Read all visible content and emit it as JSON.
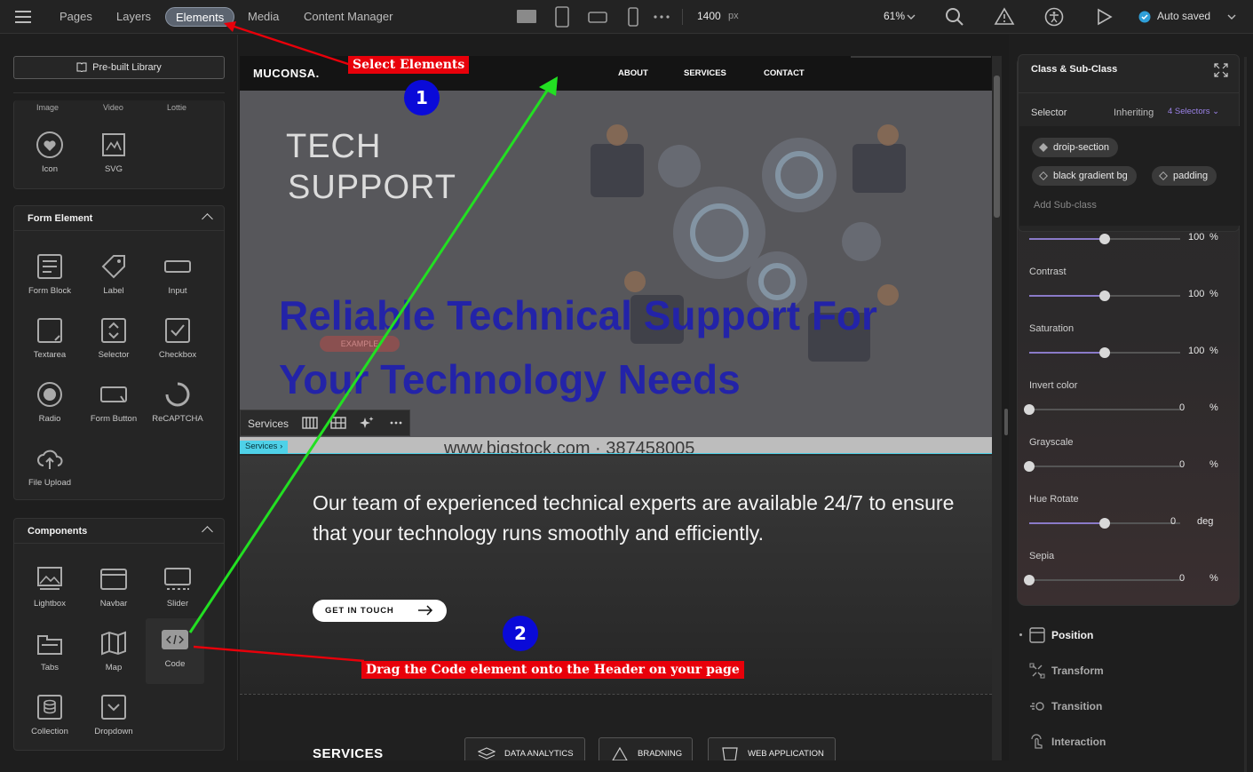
{
  "topbar": {
    "tabs": [
      "Pages",
      "Layers",
      "Elements",
      "Media",
      "Content Manager"
    ],
    "width_value": "1400",
    "width_unit": "px",
    "zoom": "61%",
    "save_status": "Auto saved"
  },
  "leftpanel": {
    "library_button": "Pre-built Library",
    "partial_labels": [
      "Image",
      "Video",
      "Lottie"
    ],
    "basic_items": [
      "Icon",
      "SVG"
    ],
    "form_title": "Form Element",
    "form_items": [
      "Form Block",
      "Label",
      "Input",
      "Textarea",
      "Selector",
      "Checkbox",
      "Radio",
      "Form Button",
      "ReCAPTCHA",
      "File Upload"
    ],
    "components_title": "Components",
    "component_items": [
      "Lightbox",
      "Navbar",
      "Slider",
      "Tabs",
      "Map",
      "Code",
      "Collection",
      "Dropdown"
    ]
  },
  "site": {
    "brand": "MUCONSA.",
    "nav_links": [
      "ABOUT",
      "SERVICES",
      "CONTACT"
    ],
    "hero_image_title_1": "TECH",
    "hero_image_title_2": "SUPPORT",
    "hero_example_tag": "EXAMPLE",
    "hero_heading_1": "Reliable Technical Support For",
    "hero_heading_2": "Your Technology Needs",
    "hero_footer_partial": "www.bigstock.com · 387458005",
    "toolbar_label": "Services",
    "breadcrumb": "Services",
    "body_text": "Our team of experienced technical experts are available 24/7 to ensure that your technology runs smoothly and efficiently.",
    "cta": "GET IN TOUCH",
    "services_heading": "SERVICES",
    "service_pills": [
      "DATA ANALYTICS",
      "BRADNING",
      "WEB APPLICATION"
    ]
  },
  "rightpanel": {
    "class_title": "Class & Sub-Class",
    "selector_label": "Selector",
    "inheriting_label": "Inheriting",
    "selectors_count": "4 Selectors",
    "chips": [
      "droip-section",
      "black gradient bg",
      "padding"
    ],
    "add_subclass": "Add Sub-class",
    "sliders": [
      {
        "label": "",
        "value": "100",
        "unit": "%",
        "level": 0.5
      },
      {
        "label": "Contrast",
        "value": "100",
        "unit": "%",
        "level": 0.5
      },
      {
        "label": "Saturation",
        "value": "100",
        "unit": "%",
        "level": 0.5
      },
      {
        "label": "Invert color",
        "value": "0",
        "unit": "%",
        "level": 0
      },
      {
        "label": "Grayscale",
        "value": "0",
        "unit": "%",
        "level": 0
      },
      {
        "label": "Hue Rotate",
        "value": "0",
        "unit": "deg",
        "level": 0.5
      },
      {
        "label": "Sepia",
        "value": "0",
        "unit": "%",
        "level": 0
      }
    ],
    "sections": [
      "Position",
      "Transform",
      "Transition",
      "Interaction"
    ]
  },
  "annotations": {
    "callout_1": "Select Elements",
    "badge_1": "1",
    "callout_2": "Drag the Code element onto the Header on your page",
    "badge_2": "2"
  },
  "colors": {
    "accent_purple": "#8a7ac8",
    "callout_red": "#e8000a",
    "badge_blue": "#0a0ad8",
    "arrow_green": "#22e022"
  }
}
